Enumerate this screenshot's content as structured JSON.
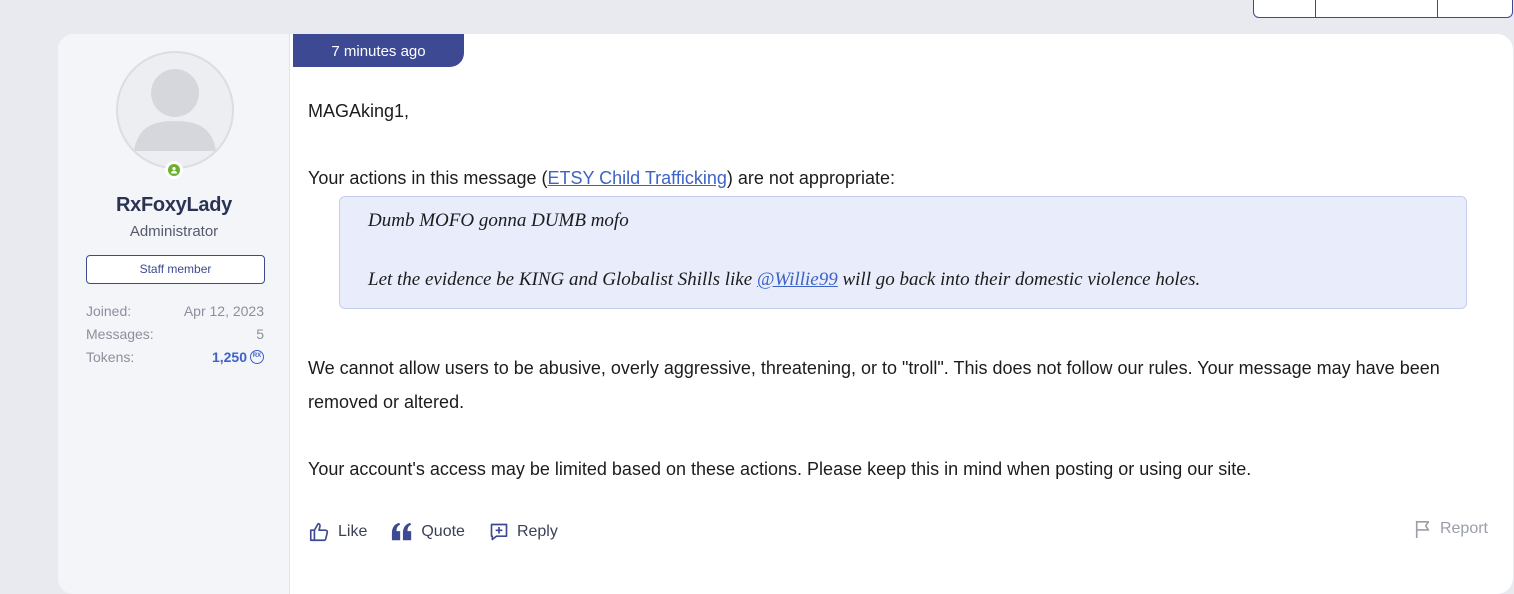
{
  "user": {
    "name": "RxFoxyLady",
    "title": "Administrator",
    "badge": "Staff member",
    "stats": [
      {
        "label": "Joined:",
        "value": "Apr 12, 2023"
      },
      {
        "label": "Messages:",
        "value": "5"
      },
      {
        "label": "Tokens:",
        "value": "1,250"
      }
    ],
    "token_coin": "RX"
  },
  "post": {
    "time": "7 minutes ago",
    "greeting": "MAGAking1,",
    "actions_before": "Your actions in this message (",
    "link": "ETSY Child Trafficking",
    "actions_after": ") are not appropriate:",
    "quote_line1": "Dumb MOFO gonna DUMB mofo",
    "quote_line2_before": "Let the evidence be KING and Globalist Shills like ",
    "quote_mention": "@Willie99",
    "quote_line2_after": " will go back into their domestic violence holes.",
    "para1": "We cannot allow users to be abusive, overly aggressive, threatening, or to \"troll\". This does not follow our rules. Your message may have been removed or altered.",
    "para2": "Your account's access may be limited based on these actions. Please keep this in mind when posting or using our site."
  },
  "actions": {
    "like": "Like",
    "quote": "Quote",
    "reply": "Reply",
    "report": "Report"
  },
  "colors": {
    "accent": "#3d4a93",
    "link": "#3d63c6",
    "online": "#6bb22c",
    "quote_bg": "#e8ecfb"
  },
  "icons": [
    "thumbs-up-icon",
    "quote-icon",
    "reply-icon",
    "flag-icon",
    "user-icon"
  ]
}
